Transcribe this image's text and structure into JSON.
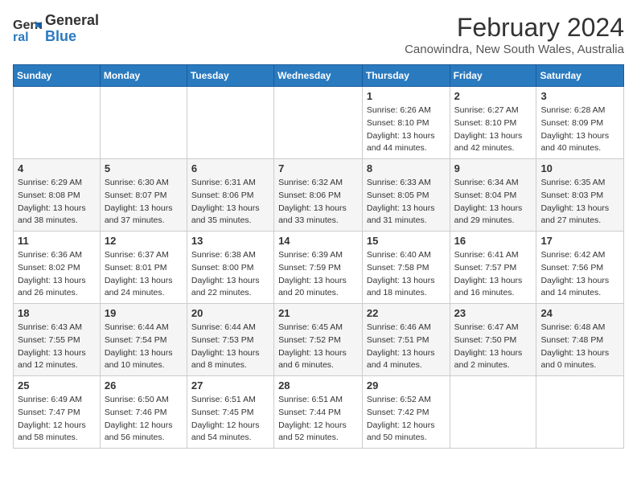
{
  "logo": {
    "line1": "General",
    "line2": "Blue"
  },
  "title": "February 2024",
  "subtitle": "Canowindra, New South Wales, Australia",
  "days_of_week": [
    "Sunday",
    "Monday",
    "Tuesday",
    "Wednesday",
    "Thursday",
    "Friday",
    "Saturday"
  ],
  "weeks": [
    [
      {
        "day": "",
        "sunrise": "",
        "sunset": "",
        "daylight": ""
      },
      {
        "day": "",
        "sunrise": "",
        "sunset": "",
        "daylight": ""
      },
      {
        "day": "",
        "sunrise": "",
        "sunset": "",
        "daylight": ""
      },
      {
        "day": "",
        "sunrise": "",
        "sunset": "",
        "daylight": ""
      },
      {
        "day": "1",
        "sunrise": "Sunrise: 6:26 AM",
        "sunset": "Sunset: 8:10 PM",
        "daylight": "Daylight: 13 hours and 44 minutes."
      },
      {
        "day": "2",
        "sunrise": "Sunrise: 6:27 AM",
        "sunset": "Sunset: 8:10 PM",
        "daylight": "Daylight: 13 hours and 42 minutes."
      },
      {
        "day": "3",
        "sunrise": "Sunrise: 6:28 AM",
        "sunset": "Sunset: 8:09 PM",
        "daylight": "Daylight: 13 hours and 40 minutes."
      }
    ],
    [
      {
        "day": "4",
        "sunrise": "Sunrise: 6:29 AM",
        "sunset": "Sunset: 8:08 PM",
        "daylight": "Daylight: 13 hours and 38 minutes."
      },
      {
        "day": "5",
        "sunrise": "Sunrise: 6:30 AM",
        "sunset": "Sunset: 8:07 PM",
        "daylight": "Daylight: 13 hours and 37 minutes."
      },
      {
        "day": "6",
        "sunrise": "Sunrise: 6:31 AM",
        "sunset": "Sunset: 8:06 PM",
        "daylight": "Daylight: 13 hours and 35 minutes."
      },
      {
        "day": "7",
        "sunrise": "Sunrise: 6:32 AM",
        "sunset": "Sunset: 8:06 PM",
        "daylight": "Daylight: 13 hours and 33 minutes."
      },
      {
        "day": "8",
        "sunrise": "Sunrise: 6:33 AM",
        "sunset": "Sunset: 8:05 PM",
        "daylight": "Daylight: 13 hours and 31 minutes."
      },
      {
        "day": "9",
        "sunrise": "Sunrise: 6:34 AM",
        "sunset": "Sunset: 8:04 PM",
        "daylight": "Daylight: 13 hours and 29 minutes."
      },
      {
        "day": "10",
        "sunrise": "Sunrise: 6:35 AM",
        "sunset": "Sunset: 8:03 PM",
        "daylight": "Daylight: 13 hours and 27 minutes."
      }
    ],
    [
      {
        "day": "11",
        "sunrise": "Sunrise: 6:36 AM",
        "sunset": "Sunset: 8:02 PM",
        "daylight": "Daylight: 13 hours and 26 minutes."
      },
      {
        "day": "12",
        "sunrise": "Sunrise: 6:37 AM",
        "sunset": "Sunset: 8:01 PM",
        "daylight": "Daylight: 13 hours and 24 minutes."
      },
      {
        "day": "13",
        "sunrise": "Sunrise: 6:38 AM",
        "sunset": "Sunset: 8:00 PM",
        "daylight": "Daylight: 13 hours and 22 minutes."
      },
      {
        "day": "14",
        "sunrise": "Sunrise: 6:39 AM",
        "sunset": "Sunset: 7:59 PM",
        "daylight": "Daylight: 13 hours and 20 minutes."
      },
      {
        "day": "15",
        "sunrise": "Sunrise: 6:40 AM",
        "sunset": "Sunset: 7:58 PM",
        "daylight": "Daylight: 13 hours and 18 minutes."
      },
      {
        "day": "16",
        "sunrise": "Sunrise: 6:41 AM",
        "sunset": "Sunset: 7:57 PM",
        "daylight": "Daylight: 13 hours and 16 minutes."
      },
      {
        "day": "17",
        "sunrise": "Sunrise: 6:42 AM",
        "sunset": "Sunset: 7:56 PM",
        "daylight": "Daylight: 13 hours and 14 minutes."
      }
    ],
    [
      {
        "day": "18",
        "sunrise": "Sunrise: 6:43 AM",
        "sunset": "Sunset: 7:55 PM",
        "daylight": "Daylight: 13 hours and 12 minutes."
      },
      {
        "day": "19",
        "sunrise": "Sunrise: 6:44 AM",
        "sunset": "Sunset: 7:54 PM",
        "daylight": "Daylight: 13 hours and 10 minutes."
      },
      {
        "day": "20",
        "sunrise": "Sunrise: 6:44 AM",
        "sunset": "Sunset: 7:53 PM",
        "daylight": "Daylight: 13 hours and 8 minutes."
      },
      {
        "day": "21",
        "sunrise": "Sunrise: 6:45 AM",
        "sunset": "Sunset: 7:52 PM",
        "daylight": "Daylight: 13 hours and 6 minutes."
      },
      {
        "day": "22",
        "sunrise": "Sunrise: 6:46 AM",
        "sunset": "Sunset: 7:51 PM",
        "daylight": "Daylight: 13 hours and 4 minutes."
      },
      {
        "day": "23",
        "sunrise": "Sunrise: 6:47 AM",
        "sunset": "Sunset: 7:50 PM",
        "daylight": "Daylight: 13 hours and 2 minutes."
      },
      {
        "day": "24",
        "sunrise": "Sunrise: 6:48 AM",
        "sunset": "Sunset: 7:48 PM",
        "daylight": "Daylight: 13 hours and 0 minutes."
      }
    ],
    [
      {
        "day": "25",
        "sunrise": "Sunrise: 6:49 AM",
        "sunset": "Sunset: 7:47 PM",
        "daylight": "Daylight: 12 hours and 58 minutes."
      },
      {
        "day": "26",
        "sunrise": "Sunrise: 6:50 AM",
        "sunset": "Sunset: 7:46 PM",
        "daylight": "Daylight: 12 hours and 56 minutes."
      },
      {
        "day": "27",
        "sunrise": "Sunrise: 6:51 AM",
        "sunset": "Sunset: 7:45 PM",
        "daylight": "Daylight: 12 hours and 54 minutes."
      },
      {
        "day": "28",
        "sunrise": "Sunrise: 6:51 AM",
        "sunset": "Sunset: 7:44 PM",
        "daylight": "Daylight: 12 hours and 52 minutes."
      },
      {
        "day": "29",
        "sunrise": "Sunrise: 6:52 AM",
        "sunset": "Sunset: 7:42 PM",
        "daylight": "Daylight: 12 hours and 50 minutes."
      },
      {
        "day": "",
        "sunrise": "",
        "sunset": "",
        "daylight": ""
      },
      {
        "day": "",
        "sunrise": "",
        "sunset": "",
        "daylight": ""
      }
    ]
  ]
}
